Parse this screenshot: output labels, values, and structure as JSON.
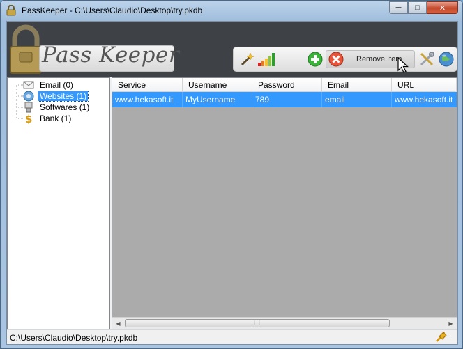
{
  "window": {
    "title": "PassKeeper - C:\\Users\\Claudio\\Desktop\\try.pkdb",
    "minimize_icon": "minimize-icon",
    "maximize_icon": "maximize-icon",
    "close_icon": "close-icon"
  },
  "header": {
    "logo_text": "Pass Keeper",
    "logo_icon": "padlock-icon"
  },
  "toolbar": {
    "buttons": [
      {
        "icon": "magic-wand-icon"
      },
      {
        "icon": "signal-strength-icon"
      },
      {
        "icon": "add-icon"
      },
      {
        "icon": "remove-icon"
      },
      {
        "icon": "tools-icon"
      },
      {
        "icon": "globe-icon"
      }
    ],
    "remove_label": "Remove Item"
  },
  "tree": {
    "items": [
      {
        "label": "Email (0)",
        "icon": "envelope-icon"
      },
      {
        "label": "Websites (1)",
        "icon": "globe-icon",
        "selected": true
      },
      {
        "label": "Softwares (1)",
        "icon": "software-icon"
      },
      {
        "label": "Bank (1)",
        "icon": "dollar-icon"
      }
    ]
  },
  "grid": {
    "columns": [
      "Service",
      "Username",
      "Password",
      "Email",
      "URL"
    ],
    "rows": [
      [
        "www.hekasoft.it",
        "MyUsername",
        "789",
        "email",
        "www.hekasoft.it"
      ]
    ],
    "scroll_grip": "III"
  },
  "status": {
    "path": "C:\\Users\\Claudio\\Desktop\\try.pkdb"
  },
  "colors": {
    "selection": "#3399ff",
    "header_bg": "#3e4246",
    "grid_bg": "#ababab"
  }
}
